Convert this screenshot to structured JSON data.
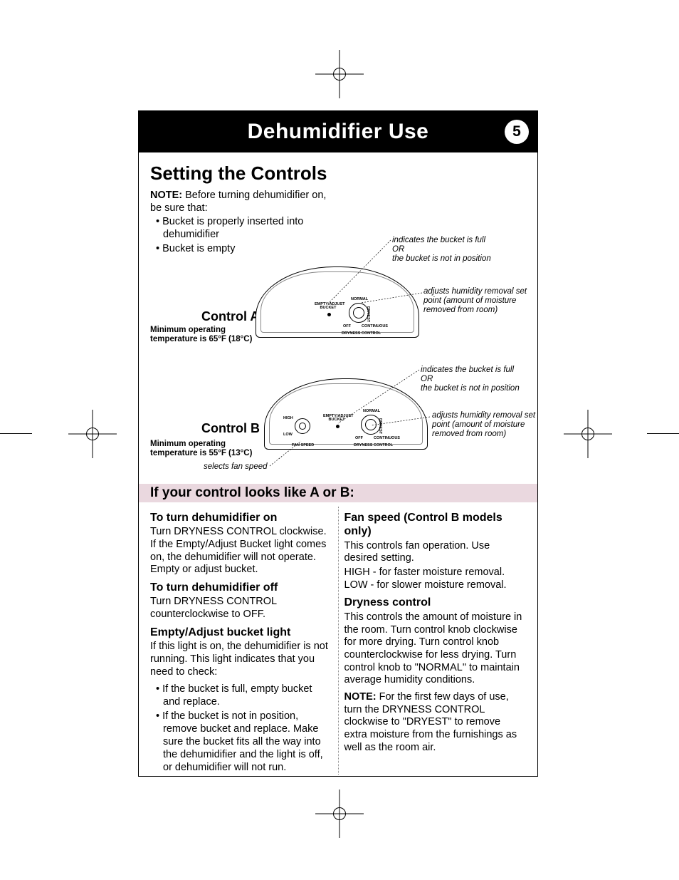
{
  "header": {
    "title": "Dehumidifier Use",
    "page_number": "5"
  },
  "section_title": "Setting the Controls",
  "intro": {
    "note_label": "NOTE:",
    "note_text": "Before turning dehumidifier on, be sure that:",
    "bullet1": "Bucket is properly inserted into dehumidifier",
    "bullet2": "Bucket is empty"
  },
  "control_a": {
    "label": "Control A",
    "min_temp": "Minimum operating temperature is 65°F (18°C)",
    "labels": {
      "empty_adjust": "EMPTY/ADJUST BUCKET",
      "normal": "NORMAL",
      "dryest": "DRYEST",
      "off": "OFF",
      "continuous": "CONTINUOUS",
      "dryness_control": "DRYNESS CONTROL"
    }
  },
  "control_b": {
    "label": "Control B",
    "min_temp": "Minimum operating temperature is 55°F (13°C)",
    "labels": {
      "empty_adjust": "EMPTY/ADJUST BUCKET",
      "normal": "NORMAL",
      "dryest": "DRYEST",
      "off": "OFF",
      "continuous": "CONTINUOUS",
      "dryness_control": "DRYNESS CONTROL",
      "fan_speed": "FAN SPEED",
      "high": "HIGH",
      "low": "LOW"
    },
    "fan_callout": "selects fan speed"
  },
  "callouts": {
    "bucket_full_1": "indicates the bucket is full",
    "bucket_full_2": "OR",
    "bucket_full_3": "the bucket is not in position",
    "humidity_1": "adjusts humidity removal set point (amount of moisture removed from room)"
  },
  "subsection_title": "If your control looks like A or B:",
  "left_col": {
    "h_on": "To turn dehumidifier on",
    "p_on": "Turn DRYNESS CONTROL clockwise. If the Empty/Adjust Bucket light comes on, the dehumidifier will not operate. Empty or adjust bucket.",
    "h_off": "To turn dehumidifier off",
    "p_off": "Turn DRYNESS CONTROL counterclockwise to OFF.",
    "h_light": "Empty/Adjust bucket light",
    "p_light": "If this light is on, the dehumidifier is not running. This light indicates that you need to check:",
    "b1": "If the bucket is full, empty bucket and replace.",
    "b2": "If the bucket is not in position, remove bucket and replace. Make sure the bucket fits all the way into the dehumidifier and the light is off, or dehumidifier will not run."
  },
  "right_col": {
    "h_fan": "Fan speed (Control B models only)",
    "p_fan1": "This controls fan operation. Use desired setting.",
    "p_fan2": "HIGH - for faster moisture removal.",
    "p_fan3": "LOW - for slower moisture removal.",
    "h_dry": "Dryness control",
    "p_dry": "This controls the amount of moisture in the room. Turn control knob clockwise for more drying. Turn control knob counterclockwise for less drying. Turn control knob to \"NORMAL\" to maintain average humidity conditions.",
    "note_label": "NOTE:",
    "p_note": "For the first few days of use, turn the DRYNESS CONTROL clockwise to \"DRYEST\" to remove extra moisture from the furnishings as well as the room air."
  }
}
